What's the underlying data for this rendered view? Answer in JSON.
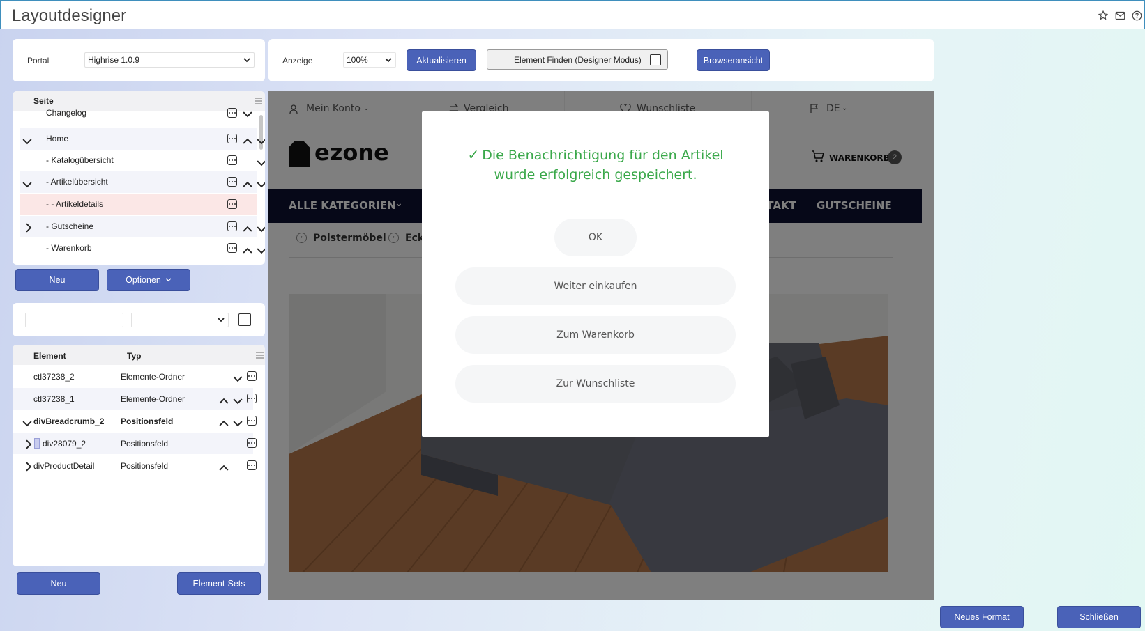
{
  "window": {
    "title": "Layoutdesigner"
  },
  "toolbar_left": {
    "portal_label": "Portal",
    "portal_value": "Highrise 1.0.9"
  },
  "toolbar_right": {
    "anzeige_label": "Anzeige",
    "zoom_value": "100%",
    "refresh_label": "Aktualisieren",
    "find_element_label": "Element Finden (Designer Modus)",
    "browser_view_label": "Browseransicht"
  },
  "page_tree": {
    "header": "Seite",
    "items": [
      {
        "label": "Changelog"
      },
      {
        "label": "Home"
      },
      {
        "label": "- Katalogübersicht"
      },
      {
        "label": "- Artikelübersicht"
      },
      {
        "label": "- - Artikeldetails"
      },
      {
        "label": "- Gutscheine"
      },
      {
        "label": "- Warenkorb"
      }
    ],
    "new_label": "Neu",
    "options_label": "Optionen"
  },
  "element_table": {
    "col_element": "Element",
    "col_type": "Typ",
    "rows": [
      {
        "element": "ctl37238_2",
        "type": "Elemente-Ordner"
      },
      {
        "element": "ctl37238_1",
        "type": "Elemente-Ordner"
      },
      {
        "element": "divBreadcrumb_2",
        "type": "Positionsfeld"
      },
      {
        "element": "div28079_2",
        "type": "Positionsfeld"
      },
      {
        "element": "divProductDetail",
        "type": "Positionsfeld"
      }
    ],
    "new_label": "Neu",
    "element_sets_label": "Element-Sets"
  },
  "shop_preview": {
    "topbar": {
      "account": "Mein Konto",
      "compare": "Vergleich",
      "wishlist": "Wunschliste",
      "language": "DE"
    },
    "logo_text": "ezone",
    "cart_label": "WARENKORB",
    "cart_count": "2",
    "nav": {
      "categories": "ALLE KATEGORIEN",
      "contact": "KONTAKT",
      "vouchers": "GUTSCHEINE"
    },
    "breadcrumb": {
      "item1": "Polstermöbel",
      "item2": "Eck"
    }
  },
  "modal": {
    "message_line1": "Die Benachrichtigung für den Artikel",
    "message_line2": "wurde erfolgreich gespeichert.",
    "ok_label": "OK",
    "continue_label": "Weiter einkaufen",
    "to_cart_label": "Zum Warenkorb",
    "to_wishlist_label": "Zur Wunschliste"
  },
  "footer": {
    "new_format_label": "Neues Format",
    "close_label": "Schließen"
  },
  "colors": {
    "primary": "#4a62b8",
    "success": "#3aa84a",
    "nav_dark": "#0c1030"
  }
}
